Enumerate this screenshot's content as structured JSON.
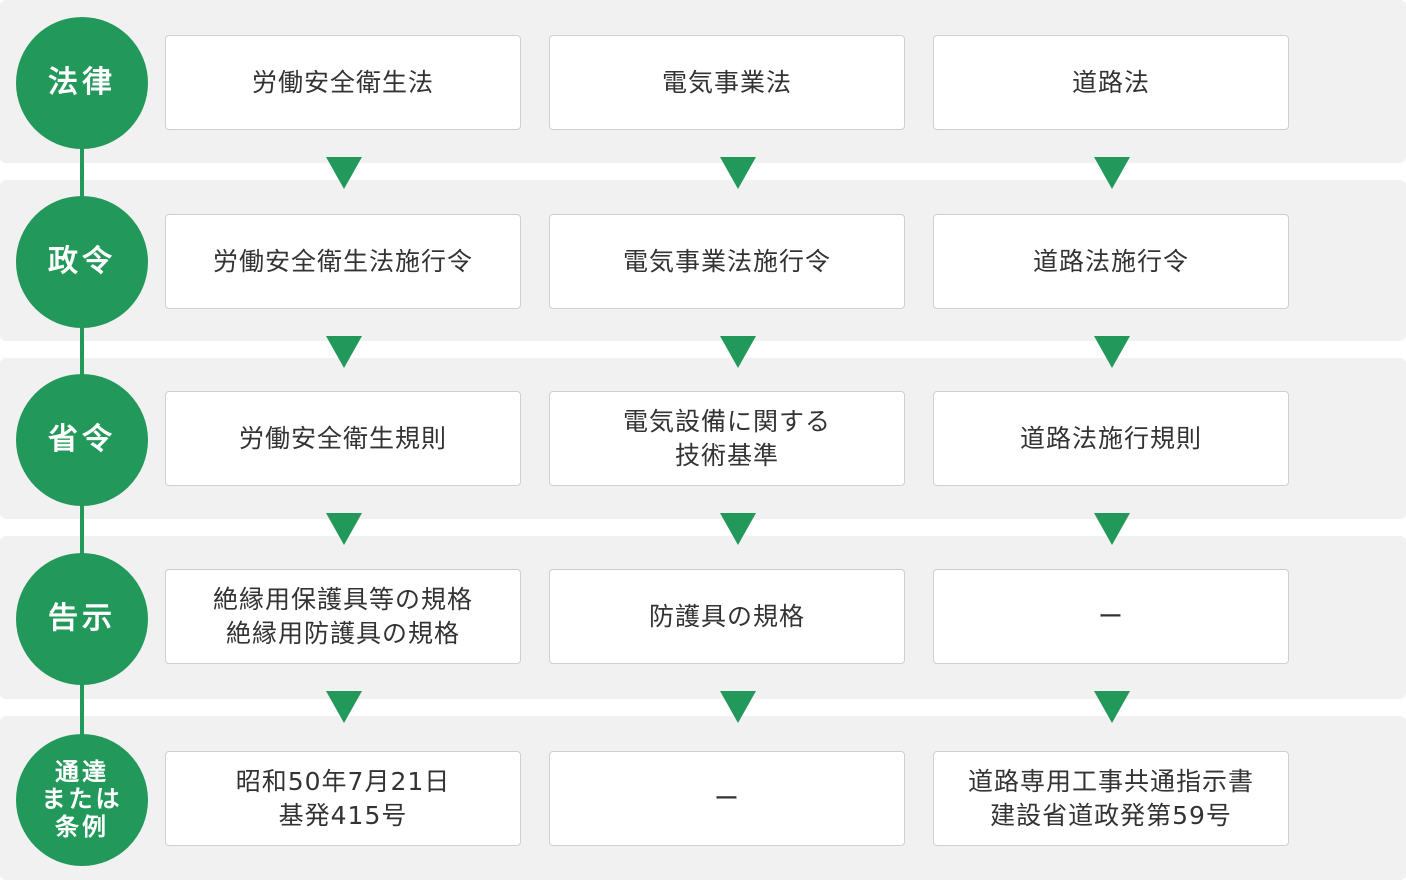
{
  "colors": {
    "accent": "#22995a",
    "band": "#f1f1f1",
    "box_border": "#cfcfcf"
  },
  "rows": [
    {
      "label": "法律",
      "cells": [
        "労働安全衛生法",
        "電気事業法",
        "道路法"
      ]
    },
    {
      "label": "政令",
      "cells": [
        "労働安全衛生法施行令",
        "電気事業法施行令",
        "道路法施行令"
      ]
    },
    {
      "label": "省令",
      "cells": [
        "労働安全衛生規則",
        "電気設備に関する\n技術基準",
        "道路法施行規則"
      ]
    },
    {
      "label": "告示",
      "cells": [
        "絶縁用保護具等の規格\n絶縁用防護具の規格",
        "防護具の規格",
        "ー"
      ]
    },
    {
      "label": "通達\nまたは\n条例",
      "cells": [
        "昭和50年7月21日\n基発415号",
        "ー",
        "道路専用工事共通指示書\n建設省道政発第59号"
      ]
    }
  ]
}
